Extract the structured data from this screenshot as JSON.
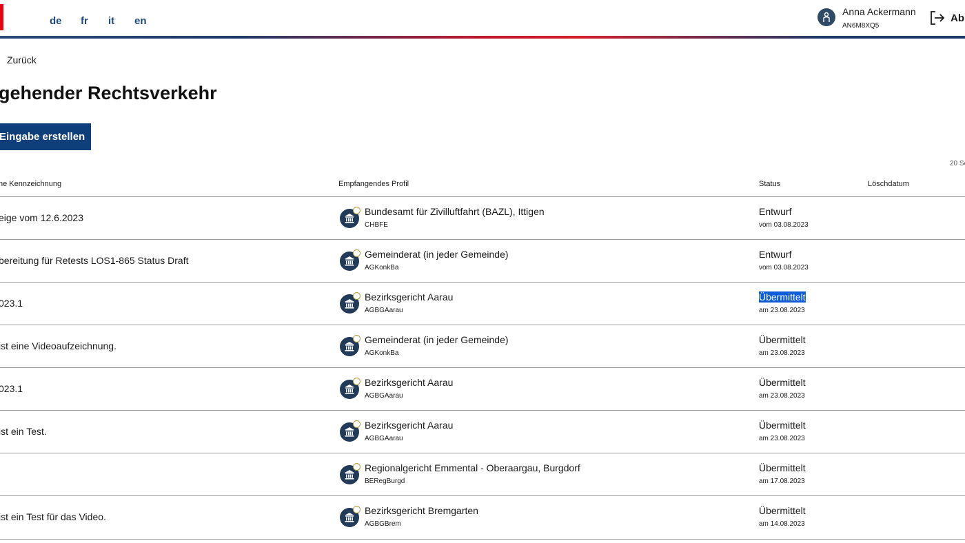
{
  "header": {
    "languages": [
      "de",
      "fr",
      "it",
      "en"
    ],
    "user_name": "Anna Ackermann",
    "user_id": "AN6M8XQ5",
    "logout_label": "Abm"
  },
  "nav": {
    "back_label": "Zurück"
  },
  "page_title": "gehender Rechtsverkehr",
  "create_button_label": "Eingabe erstellen",
  "page_count": "20 Se",
  "table": {
    "headers": {
      "name": "ne Kennzeichnung",
      "profile": "Empfangendes Profil",
      "status": "Status",
      "delete_date": "Löschdatum"
    },
    "rows": [
      {
        "name": "eige vom 12.6.2023",
        "profile": "Bundesamt für Zivilluftfahrt (BAZL), Ittigen",
        "code": "CHBFE",
        "status": "Entwurf",
        "status_date": "vom 03.08.2023"
      },
      {
        "name": "bereitung für Retests LOS1-865 Status Draft",
        "profile": "Gemeinderat (in jeder Gemeinde)",
        "code": "AGKonkBa",
        "status": "Entwurf",
        "status_date": "vom 03.08.2023"
      },
      {
        "name": "023.1",
        "profile": "Bezirksgericht Aarau",
        "code": "AGBGAarau",
        "status": "Übermittelt",
        "status_date": "am 23.08.2023",
        "selected": true
      },
      {
        "name": "ist eine Videoaufzeichnung.",
        "profile": "Gemeinderat (in jeder Gemeinde)",
        "code": "AGKonkBa",
        "status": "Übermittelt",
        "status_date": "am 23.08.2023"
      },
      {
        "name": "023.1",
        "profile": "Bezirksgericht Aarau",
        "code": "AGBGAarau",
        "status": "Übermittelt",
        "status_date": "am 23.08.2023"
      },
      {
        "name": "ist ein Test.",
        "profile": "Bezirksgericht Aarau",
        "code": "AGBGAarau",
        "status": "Übermittelt",
        "status_date": "am 23.08.2023"
      },
      {
        "name": "",
        "profile": "Regionalgericht Emmental - Oberaargau, Burgdorf",
        "code": "BERegBurgd",
        "status": "Übermittelt",
        "status_date": "am 17.08.2023"
      },
      {
        "name": "ist ein Test für das Video.",
        "profile": "Bezirksgericht Bremgarten",
        "code": "AGBGBrem",
        "status": "Übermittelt",
        "status_date": "am 14.08.2023"
      }
    ]
  },
  "colors": {
    "brand_red": "#e30613",
    "primary_blue": "#0e3f7a",
    "icon_navy": "#203a58",
    "selection_blue": "#0a5cd8"
  },
  "icons": [
    "user-icon",
    "logout-icon",
    "institution-icon"
  ]
}
